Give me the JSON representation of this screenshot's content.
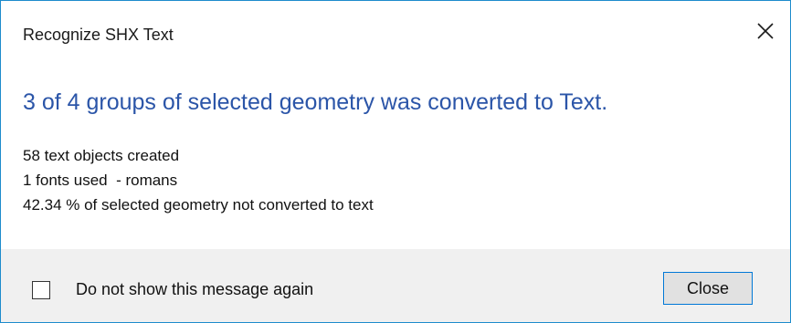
{
  "window": {
    "title": "Recognize SHX Text",
    "close_icon": "close-icon"
  },
  "message": {
    "headline": "3 of 4 groups of selected geometry was converted to Text.",
    "details": [
      "58 text objects created",
      "1 fonts used  - romans",
      "42.34 % of selected geometry not converted to text"
    ]
  },
  "footer": {
    "checkbox_label": "Do not show this message again",
    "checkbox_checked": false,
    "close_label": "Close"
  },
  "colors": {
    "accent": "#2b55a8",
    "border": "#1e8ccc",
    "footer_bg": "#f0f0f0",
    "button_focus": "#0078d7"
  }
}
